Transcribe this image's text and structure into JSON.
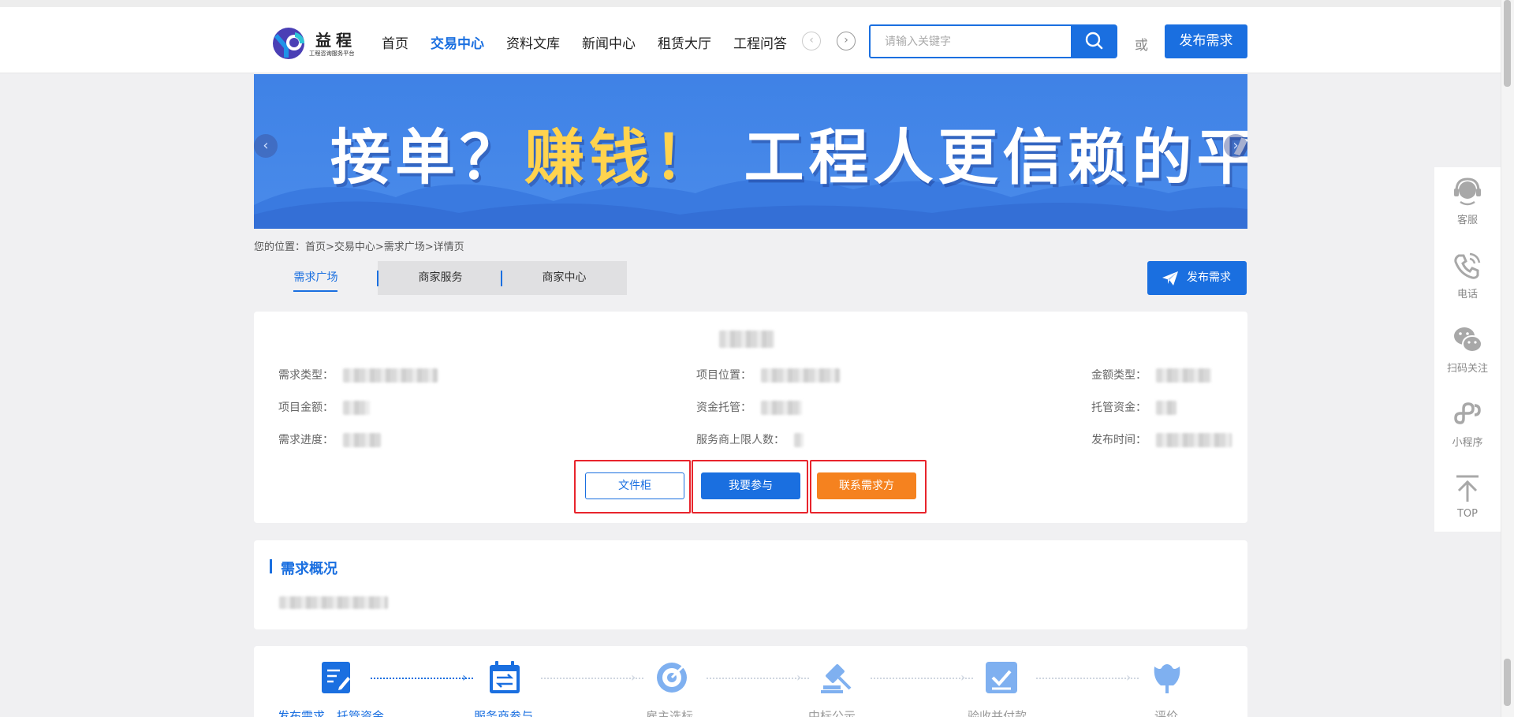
{
  "logo": {
    "name": "益程",
    "subtitle": "工程咨询服务平台"
  },
  "nav": {
    "items": [
      "首页",
      "交易中心",
      "资料文库",
      "新闻中心",
      "租赁大厅",
      "工程问答"
    ],
    "active_index": 1,
    "prev_icon": "chevron-left-icon",
    "next_icon": "chevron-right-icon"
  },
  "search": {
    "placeholder": "请输入关键字",
    "button_icon": "search-icon"
  },
  "header": {
    "or_text": "或",
    "publish_label": "发布需求"
  },
  "banner": {
    "text_part1": "接单？",
    "text_highlight": "赚钱！",
    "text_part2": " 工程人更信赖的平台"
  },
  "breadcrumb": "您的位置：首页>交易中心>需求广场>详情页",
  "tabs": [
    "需求广场",
    "商家服务",
    "商家中心"
  ],
  "active_tab": 0,
  "publish_button": {
    "label": "发布需求",
    "icon": "paper-plane-icon"
  },
  "detail": {
    "fields": {
      "demand_type": "需求类型：",
      "project_location": "项目位置：",
      "amount_type": "金额类型：",
      "project_amount": "项目金额：",
      "fund_custody": "资金托管：",
      "custody_funds": "托管资金：",
      "demand_progress": "需求进度：",
      "provider_limit": "服务商上限人数：",
      "publish_time": "发布时间："
    },
    "buttons": {
      "file_cabinet": "文件柜",
      "participate": "我要参与",
      "contact": "联系需求方"
    }
  },
  "overview": {
    "title": "需求概况"
  },
  "steps": [
    {
      "label": "发布需求、托管资金",
      "icon": "document-edit-icon"
    },
    {
      "label": "服务商参与",
      "icon": "calendar-swap-icon"
    },
    {
      "label": "雇主选标",
      "icon": "target-icon"
    },
    {
      "label": "中标公示",
      "icon": "gavel-icon"
    },
    {
      "label": "验收并付款",
      "icon": "checkbox-icon"
    },
    {
      "label": "评价",
      "icon": "tulip-icon"
    }
  ],
  "sidebar": [
    {
      "label": "客服",
      "icon": "headset-icon"
    },
    {
      "label": "电话",
      "icon": "phone-icon"
    },
    {
      "label": "扫码关注",
      "icon": "wechat-icon"
    },
    {
      "label": "小程序",
      "icon": "mini-program-icon"
    },
    {
      "label": "TOP",
      "icon": "arrow-up-icon"
    }
  ],
  "colors": {
    "brand_blue": "#1a6fe0",
    "orange": "#f5821f",
    "highlight_red": "#e8242c",
    "banner_yellow": "#ffd34e"
  }
}
